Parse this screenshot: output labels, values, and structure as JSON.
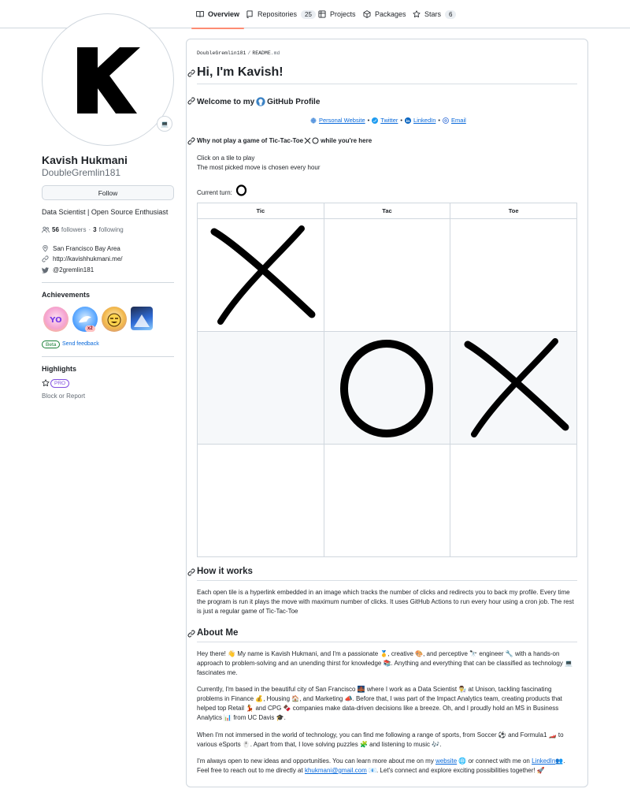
{
  "tabs": [
    {
      "label": "Overview",
      "active": true,
      "icon": "book-icon"
    },
    {
      "label": "Repositories",
      "count": "25",
      "icon": "repo-icon"
    },
    {
      "label": "Projects",
      "icon": "table-icon"
    },
    {
      "label": "Packages",
      "icon": "package-icon"
    },
    {
      "label": "Stars",
      "count": "6",
      "icon": "star-icon"
    }
  ],
  "profile": {
    "name": "Kavish Hukmani",
    "login": "DoubleGremlin181",
    "status_emoji": "💻",
    "follow_label": "Follow",
    "bio": "Data Scientist | Open Source Enthusiast",
    "followers_count": "56",
    "followers_label": "followers",
    "separator": "·",
    "following_count": "3",
    "following_label": "following",
    "location": "San Francisco Bay Area",
    "website": "http://kavishhukmani.me/",
    "twitter": "@2gremlin181"
  },
  "achievements": {
    "title": "Achievements",
    "multiplier": "x2",
    "beta_label": "Beta",
    "feedback_label": "Send feedback"
  },
  "highlights": {
    "title": "Highlights",
    "pro_label": "PRO",
    "block_label": "Block or Report"
  },
  "readme": {
    "crumb_user": "DoubleGremlin181",
    "crumb_sep": "/",
    "crumb_file": "README",
    "crumb_ext": ".md",
    "title": "Hi, I'm Kavish!",
    "welcome_pre": "Welcome to my",
    "welcome_post": "GitHub Profile",
    "links": {
      "website": "Personal Website",
      "twitter": "Twitter",
      "linkedin": "LinkedIn",
      "email": "Email",
      "bullet": "•"
    },
    "game_heading_pre": "Why not play a game of Tic-Tac-Toe",
    "game_heading_post": "while you're here",
    "instruction1": "Click on a tile to play",
    "instruction2": "The most picked move is chosen every hour",
    "current_turn_label": "Current turn:",
    "board": {
      "headers": [
        "Tic",
        "Tac",
        "Toe"
      ],
      "rows": [
        [
          "X",
          "",
          ""
        ],
        [
          "",
          "O",
          "X"
        ],
        [
          "",
          "",
          ""
        ]
      ]
    },
    "how_title": "How it works",
    "how_text": "Each open tile is a hyperlink embedded in an image which tracks the number of clicks and redirects you to back my profile. Every time the program is run it plays the move with maximum number of clicks. It uses GitHub Actions to run every hour using a cron job. The rest is just a regular game of Tic-Tac-Toe",
    "about_title": "About Me",
    "about_p1": "Hey there! 👋 My name is Kavish Hukmani, and I'm a passionate 🥇, creative 🎨, and perceptive 🔭 engineer 🔧 with a hands-on approach to problem-solving and an unending thirst for knowledge 📚. Anything and everything that can be classified as technology 💻 fascinates me.",
    "about_p2": "Currently, I'm based in the beautiful city of San Francisco 🌉 where I work as a Data Scientist 👨‍🔬 at Unison, tackling fascinating problems in Finance 💰, Housing 🏠, and Marketing 📣. Before that, I was part of the Impact Analytics team, creating products that helped top Retail 💃 and CPG 🍫 companies make data-driven decisions like a breeze. Oh, and I proudly hold an MS in Business Analytics 📊 from UC Davis 🎓.",
    "about_p3": "When I'm not immersed in the world of technology, you can find me following a range of sports, from Soccer ⚽ and Formula1 🏎️ to various eSports 🖱️. Apart from that, I love solving puzzles 🧩 and listening to music 🎶.",
    "about_p4_a": "I'm always open to new ideas and opportunities. You can learn more about me on my",
    "about_p4_website": "website",
    "about_p4_b": "🌐 or connect with me on",
    "about_p4_linkedin": "LinkedIn",
    "about_p4_c": "👥. Feel free to reach out to me directly at",
    "about_p4_email": "khukmani@gmail.com",
    "about_p4_d": "📧. Let's connect and explore exciting possibilities together! 🚀"
  },
  "colors": {
    "link": "#0969da",
    "tab_underline": "#fd8c73",
    "border": "#d0d7de"
  }
}
